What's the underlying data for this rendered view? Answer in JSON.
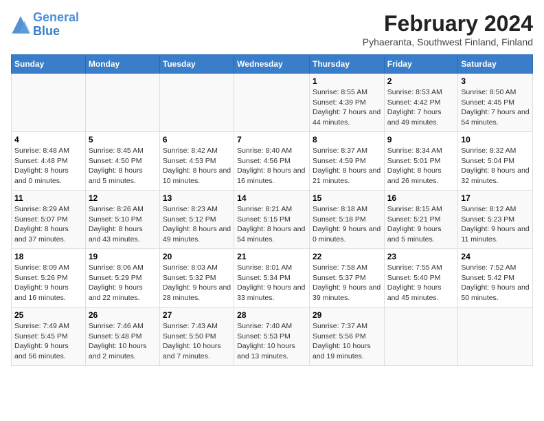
{
  "logo": {
    "line1": "General",
    "line2": "Blue"
  },
  "title": "February 2024",
  "subtitle": "Pyhaeranta, Southwest Finland, Finland",
  "days_of_week": [
    "Sunday",
    "Monday",
    "Tuesday",
    "Wednesday",
    "Thursday",
    "Friday",
    "Saturday"
  ],
  "weeks": [
    [
      {
        "day": "",
        "info": ""
      },
      {
        "day": "",
        "info": ""
      },
      {
        "day": "",
        "info": ""
      },
      {
        "day": "",
        "info": ""
      },
      {
        "day": "1",
        "info": "Sunrise: 8:55 AM\nSunset: 4:39 PM\nDaylight: 7 hours and 44 minutes."
      },
      {
        "day": "2",
        "info": "Sunrise: 8:53 AM\nSunset: 4:42 PM\nDaylight: 7 hours and 49 minutes."
      },
      {
        "day": "3",
        "info": "Sunrise: 8:50 AM\nSunset: 4:45 PM\nDaylight: 7 hours and 54 minutes."
      }
    ],
    [
      {
        "day": "4",
        "info": "Sunrise: 8:48 AM\nSunset: 4:48 PM\nDaylight: 8 hours and 0 minutes."
      },
      {
        "day": "5",
        "info": "Sunrise: 8:45 AM\nSunset: 4:50 PM\nDaylight: 8 hours and 5 minutes."
      },
      {
        "day": "6",
        "info": "Sunrise: 8:42 AM\nSunset: 4:53 PM\nDaylight: 8 hours and 10 minutes."
      },
      {
        "day": "7",
        "info": "Sunrise: 8:40 AM\nSunset: 4:56 PM\nDaylight: 8 hours and 16 minutes."
      },
      {
        "day": "8",
        "info": "Sunrise: 8:37 AM\nSunset: 4:59 PM\nDaylight: 8 hours and 21 minutes."
      },
      {
        "day": "9",
        "info": "Sunrise: 8:34 AM\nSunset: 5:01 PM\nDaylight: 8 hours and 26 minutes."
      },
      {
        "day": "10",
        "info": "Sunrise: 8:32 AM\nSunset: 5:04 PM\nDaylight: 8 hours and 32 minutes."
      }
    ],
    [
      {
        "day": "11",
        "info": "Sunrise: 8:29 AM\nSunset: 5:07 PM\nDaylight: 8 hours and 37 minutes."
      },
      {
        "day": "12",
        "info": "Sunrise: 8:26 AM\nSunset: 5:10 PM\nDaylight: 8 hours and 43 minutes."
      },
      {
        "day": "13",
        "info": "Sunrise: 8:23 AM\nSunset: 5:12 PM\nDaylight: 8 hours and 49 minutes."
      },
      {
        "day": "14",
        "info": "Sunrise: 8:21 AM\nSunset: 5:15 PM\nDaylight: 8 hours and 54 minutes."
      },
      {
        "day": "15",
        "info": "Sunrise: 8:18 AM\nSunset: 5:18 PM\nDaylight: 9 hours and 0 minutes."
      },
      {
        "day": "16",
        "info": "Sunrise: 8:15 AM\nSunset: 5:21 PM\nDaylight: 9 hours and 5 minutes."
      },
      {
        "day": "17",
        "info": "Sunrise: 8:12 AM\nSunset: 5:23 PM\nDaylight: 9 hours and 11 minutes."
      }
    ],
    [
      {
        "day": "18",
        "info": "Sunrise: 8:09 AM\nSunset: 5:26 PM\nDaylight: 9 hours and 16 minutes."
      },
      {
        "day": "19",
        "info": "Sunrise: 8:06 AM\nSunset: 5:29 PM\nDaylight: 9 hours and 22 minutes."
      },
      {
        "day": "20",
        "info": "Sunrise: 8:03 AM\nSunset: 5:32 PM\nDaylight: 9 hours and 28 minutes."
      },
      {
        "day": "21",
        "info": "Sunrise: 8:01 AM\nSunset: 5:34 PM\nDaylight: 9 hours and 33 minutes."
      },
      {
        "day": "22",
        "info": "Sunrise: 7:58 AM\nSunset: 5:37 PM\nDaylight: 9 hours and 39 minutes."
      },
      {
        "day": "23",
        "info": "Sunrise: 7:55 AM\nSunset: 5:40 PM\nDaylight: 9 hours and 45 minutes."
      },
      {
        "day": "24",
        "info": "Sunrise: 7:52 AM\nSunset: 5:42 PM\nDaylight: 9 hours and 50 minutes."
      }
    ],
    [
      {
        "day": "25",
        "info": "Sunrise: 7:49 AM\nSunset: 5:45 PM\nDaylight: 9 hours and 56 minutes."
      },
      {
        "day": "26",
        "info": "Sunrise: 7:46 AM\nSunset: 5:48 PM\nDaylight: 10 hours and 2 minutes."
      },
      {
        "day": "27",
        "info": "Sunrise: 7:43 AM\nSunset: 5:50 PM\nDaylight: 10 hours and 7 minutes."
      },
      {
        "day": "28",
        "info": "Sunrise: 7:40 AM\nSunset: 5:53 PM\nDaylight: 10 hours and 13 minutes."
      },
      {
        "day": "29",
        "info": "Sunrise: 7:37 AM\nSunset: 5:56 PM\nDaylight: 10 hours and 19 minutes."
      },
      {
        "day": "",
        "info": ""
      },
      {
        "day": "",
        "info": ""
      }
    ]
  ]
}
